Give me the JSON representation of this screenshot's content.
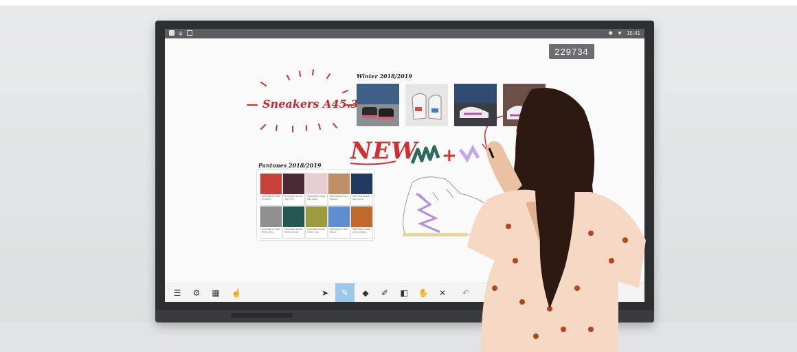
{
  "status_bar": {
    "time": "15:41"
  },
  "board": {
    "room_code": "229734",
    "sneakers_label": "Sneakers A45.3",
    "winter_label": "Winter 2018/2019",
    "pantones_label": "Pantones 2018/2019",
    "new_label": "NEW",
    "plus_label": "+"
  },
  "swatches": [
    {
      "color": "#c8403c",
      "code": "PANTONE 17-1456",
      "name": "Grenadine"
    },
    {
      "color": "#4b2a33",
      "code": "PANTONE 19-1718",
      "name": "Spicy Port"
    },
    {
      "color": "#e6cfd3",
      "code": "PANTONE 13-2803",
      "name": "Pale Sugar"
    },
    {
      "color": "#bf8f66",
      "code": "PANTONE 16-1331",
      "name": "Mustang"
    },
    {
      "color": "#233a60",
      "code": "PANTONE 19-4027",
      "name": "Navy Peony"
    },
    {
      "color": "#8e9090",
      "code": "PANTONE 17-1500",
      "name": "Harbor Gray"
    },
    {
      "color": "#22584f",
      "code": "PANTONE 18-5622",
      "name": "Shaded Spruce"
    },
    {
      "color": "#9a9c3c",
      "code": "PANTONE 16-0540",
      "name": "Golden Lime"
    },
    {
      "color": "#5e8ed0",
      "code": "PANTONE 17-4041",
      "name": "Marina"
    },
    {
      "color": "#c0672b",
      "code": "PANTONE 17-1145",
      "name": "Autumn Maple"
    }
  ],
  "photos": [
    {
      "name": "sneaker-photo-1",
      "bg": "#8a8f94"
    },
    {
      "name": "sneaker-photo-2",
      "bg": "#e8e6e2"
    },
    {
      "name": "sneaker-photo-3",
      "bg": "#3c3d40"
    },
    {
      "name": "sneaker-photo-4",
      "bg": "#6b5048"
    }
  ],
  "toolbar": {
    "left_tools": [
      "menu-icon",
      "settings-icon",
      "qr-icon",
      "touch-icon"
    ],
    "center_tools": [
      "select-icon",
      "pen-icon",
      "eraser-icon",
      "highlighter-icon",
      "shapes-icon",
      "hand-icon",
      "close-icon"
    ],
    "active_tool": "pen-icon"
  },
  "colors": {
    "accent_red": "#d32f2f",
    "toolbar_active": "#9cc8ee",
    "bezel": "#2e2f31"
  }
}
